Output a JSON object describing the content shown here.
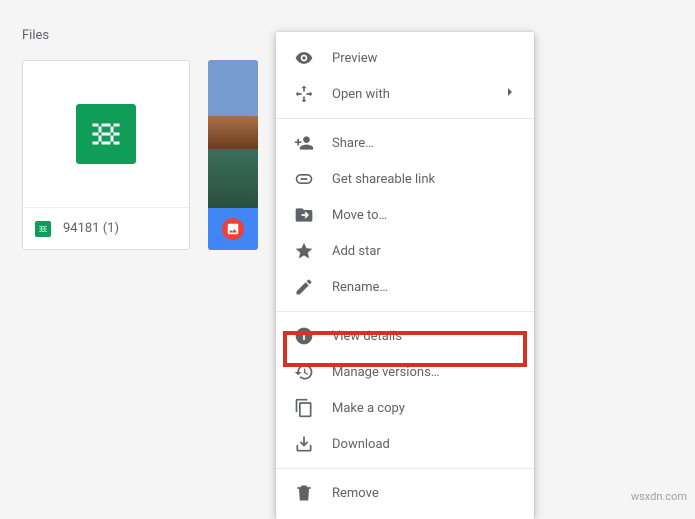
{
  "section_label": "Files",
  "files": {
    "sheet": {
      "name": "94181 (1)"
    }
  },
  "menu": {
    "preview": "Preview",
    "open_with": "Open with",
    "share": "Share…",
    "get_link": "Get shareable link",
    "move_to": "Move to…",
    "add_star": "Add star",
    "rename": "Rename…",
    "view_details": "View details",
    "manage_versions": "Manage versions…",
    "make_copy": "Make a copy",
    "download": "Download",
    "remove": "Remove"
  },
  "watermark": "wsxdn.com"
}
